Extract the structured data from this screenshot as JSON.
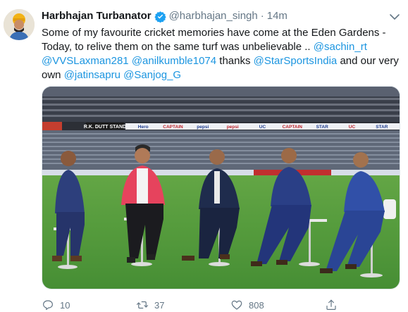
{
  "tweet": {
    "display_name": "Harbhajan Turbanator",
    "handle": "@harbhajan_singh",
    "separator": "·",
    "time": "14m",
    "text_parts": [
      {
        "t": "Some of my favourite cricket memories have come at the Eden Gardens - Today, to relive them on the same turf was unbelievable .. ",
        "m": false
      },
      {
        "t": "@sachin_rt",
        "m": true
      },
      {
        "t": " ",
        "m": false
      },
      {
        "t": "@VVSLaxman281",
        "m": true
      },
      {
        "t": " ",
        "m": false
      },
      {
        "t": "@anilkumble1074",
        "m": true
      },
      {
        "t": " thanks ",
        "m": false
      },
      {
        "t": "@StarSportsIndia",
        "m": true
      },
      {
        "t": " and our very own ",
        "m": false
      },
      {
        "t": "@jatinsapru",
        "m": true
      },
      {
        "t": " ",
        "m": false
      },
      {
        "t": "@Sanjog_G",
        "m": true
      }
    ],
    "photo": {
      "banner_text": "R.K. DUTT STAND",
      "ad_texts": [
        "Hero",
        "CAPTAIN",
        "pepsi",
        "pepsi",
        "UC",
        "CAPTAIN",
        "STAR",
        "UC",
        "STAR"
      ]
    },
    "actions": {
      "reply_count": "10",
      "retweet_count": "37",
      "like_count": "808"
    }
  },
  "colors": {
    "link": "#1b95e0",
    "muted": "#657786",
    "text": "#14171a",
    "verified": "#1da1f2"
  }
}
